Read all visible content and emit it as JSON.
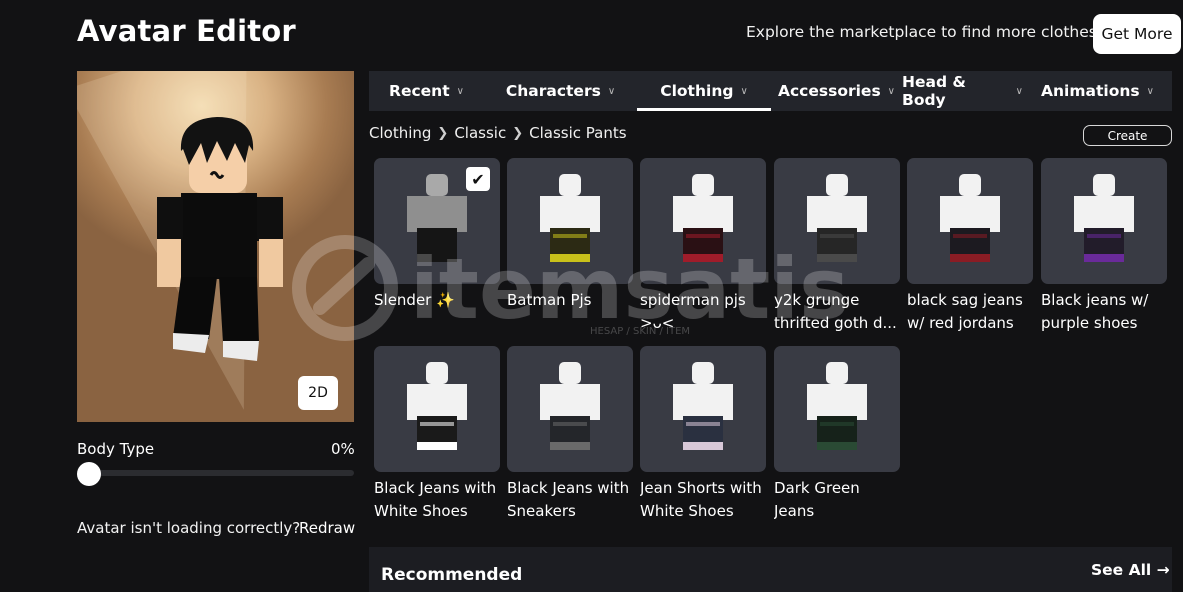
{
  "header": {
    "title": "Avatar Editor",
    "promo_text": "Explore the marketplace to find more clothes!",
    "get_more_label": "Get More"
  },
  "preview": {
    "toggle_label": "2D",
    "body_type_label": "Body Type",
    "body_type_value": "0%",
    "body_type_fraction": 0,
    "loading_text": "Avatar isn't loading correctly?",
    "redraw_label": "Redraw"
  },
  "tabs": [
    {
      "label": "Recent",
      "active": false
    },
    {
      "label": "Characters",
      "active": false
    },
    {
      "label": "Clothing",
      "active": true
    },
    {
      "label": "Accessories",
      "active": false
    },
    {
      "label": "Head & Body",
      "active": false
    },
    {
      "label": "Animations",
      "active": false
    }
  ],
  "breadcrumb": [
    "Clothing",
    "Classic",
    "Classic Pants"
  ],
  "create_label": "Create",
  "items": [
    {
      "name": "Slender ✨",
      "selected": true,
      "torso": "#8f8f8f",
      "pants": "#151515",
      "accent": "#151515"
    },
    {
      "name": "Batman Pjs",
      "selected": false,
      "torso": "#f2f2f2",
      "pants": "#2c2a14",
      "accent": "#c9c11a"
    },
    {
      "name": "spiderman pjs >ᴗ<",
      "selected": false,
      "torso": "#f2f2f2",
      "pants": "#2a1014",
      "accent": "#a01c2a"
    },
    {
      "name": "y2k grunge thrifted goth d...",
      "selected": false,
      "torso": "#f2f2f2",
      "pants": "#262626",
      "accent": "#4a4a4a"
    },
    {
      "name": "black sag jeans w/ red jordans",
      "selected": false,
      "torso": "#f2f2f2",
      "pants": "#1c1a20",
      "accent": "#8a1c24"
    },
    {
      "name": "Black jeans w/ purple shoes",
      "selected": false,
      "torso": "#f2f2f2",
      "pants": "#221c2a",
      "accent": "#6a2a9a"
    },
    {
      "name": "Black Jeans with White Shoes",
      "selected": false,
      "torso": "#f2f2f2",
      "pants": "#1a1a1a",
      "accent": "#ffffff"
    },
    {
      "name": "Black Jeans with Sneakers",
      "selected": false,
      "torso": "#f2f2f2",
      "pants": "#24262a",
      "accent": "#6a6a6a"
    },
    {
      "name": "Jean Shorts with White Shoes",
      "selected": false,
      "torso": "#f2f2f2",
      "pants": "#2a3040",
      "accent": "#d8c8d8"
    },
    {
      "name": "Dark Green Jeans",
      "selected": false,
      "torso": "#f2f2f2",
      "pants": "#16221a",
      "accent": "#2a4a34"
    }
  ],
  "recommended": {
    "title": "Recommended",
    "see_all_label": "See All"
  },
  "watermark": {
    "brand": "itemsatis",
    "tagline": "HESAP / SKIN / İTEM"
  },
  "colors": {
    "background": "#121214",
    "tab_bar": "#23252b",
    "card": "#393b44",
    "text": "#ffffff"
  }
}
